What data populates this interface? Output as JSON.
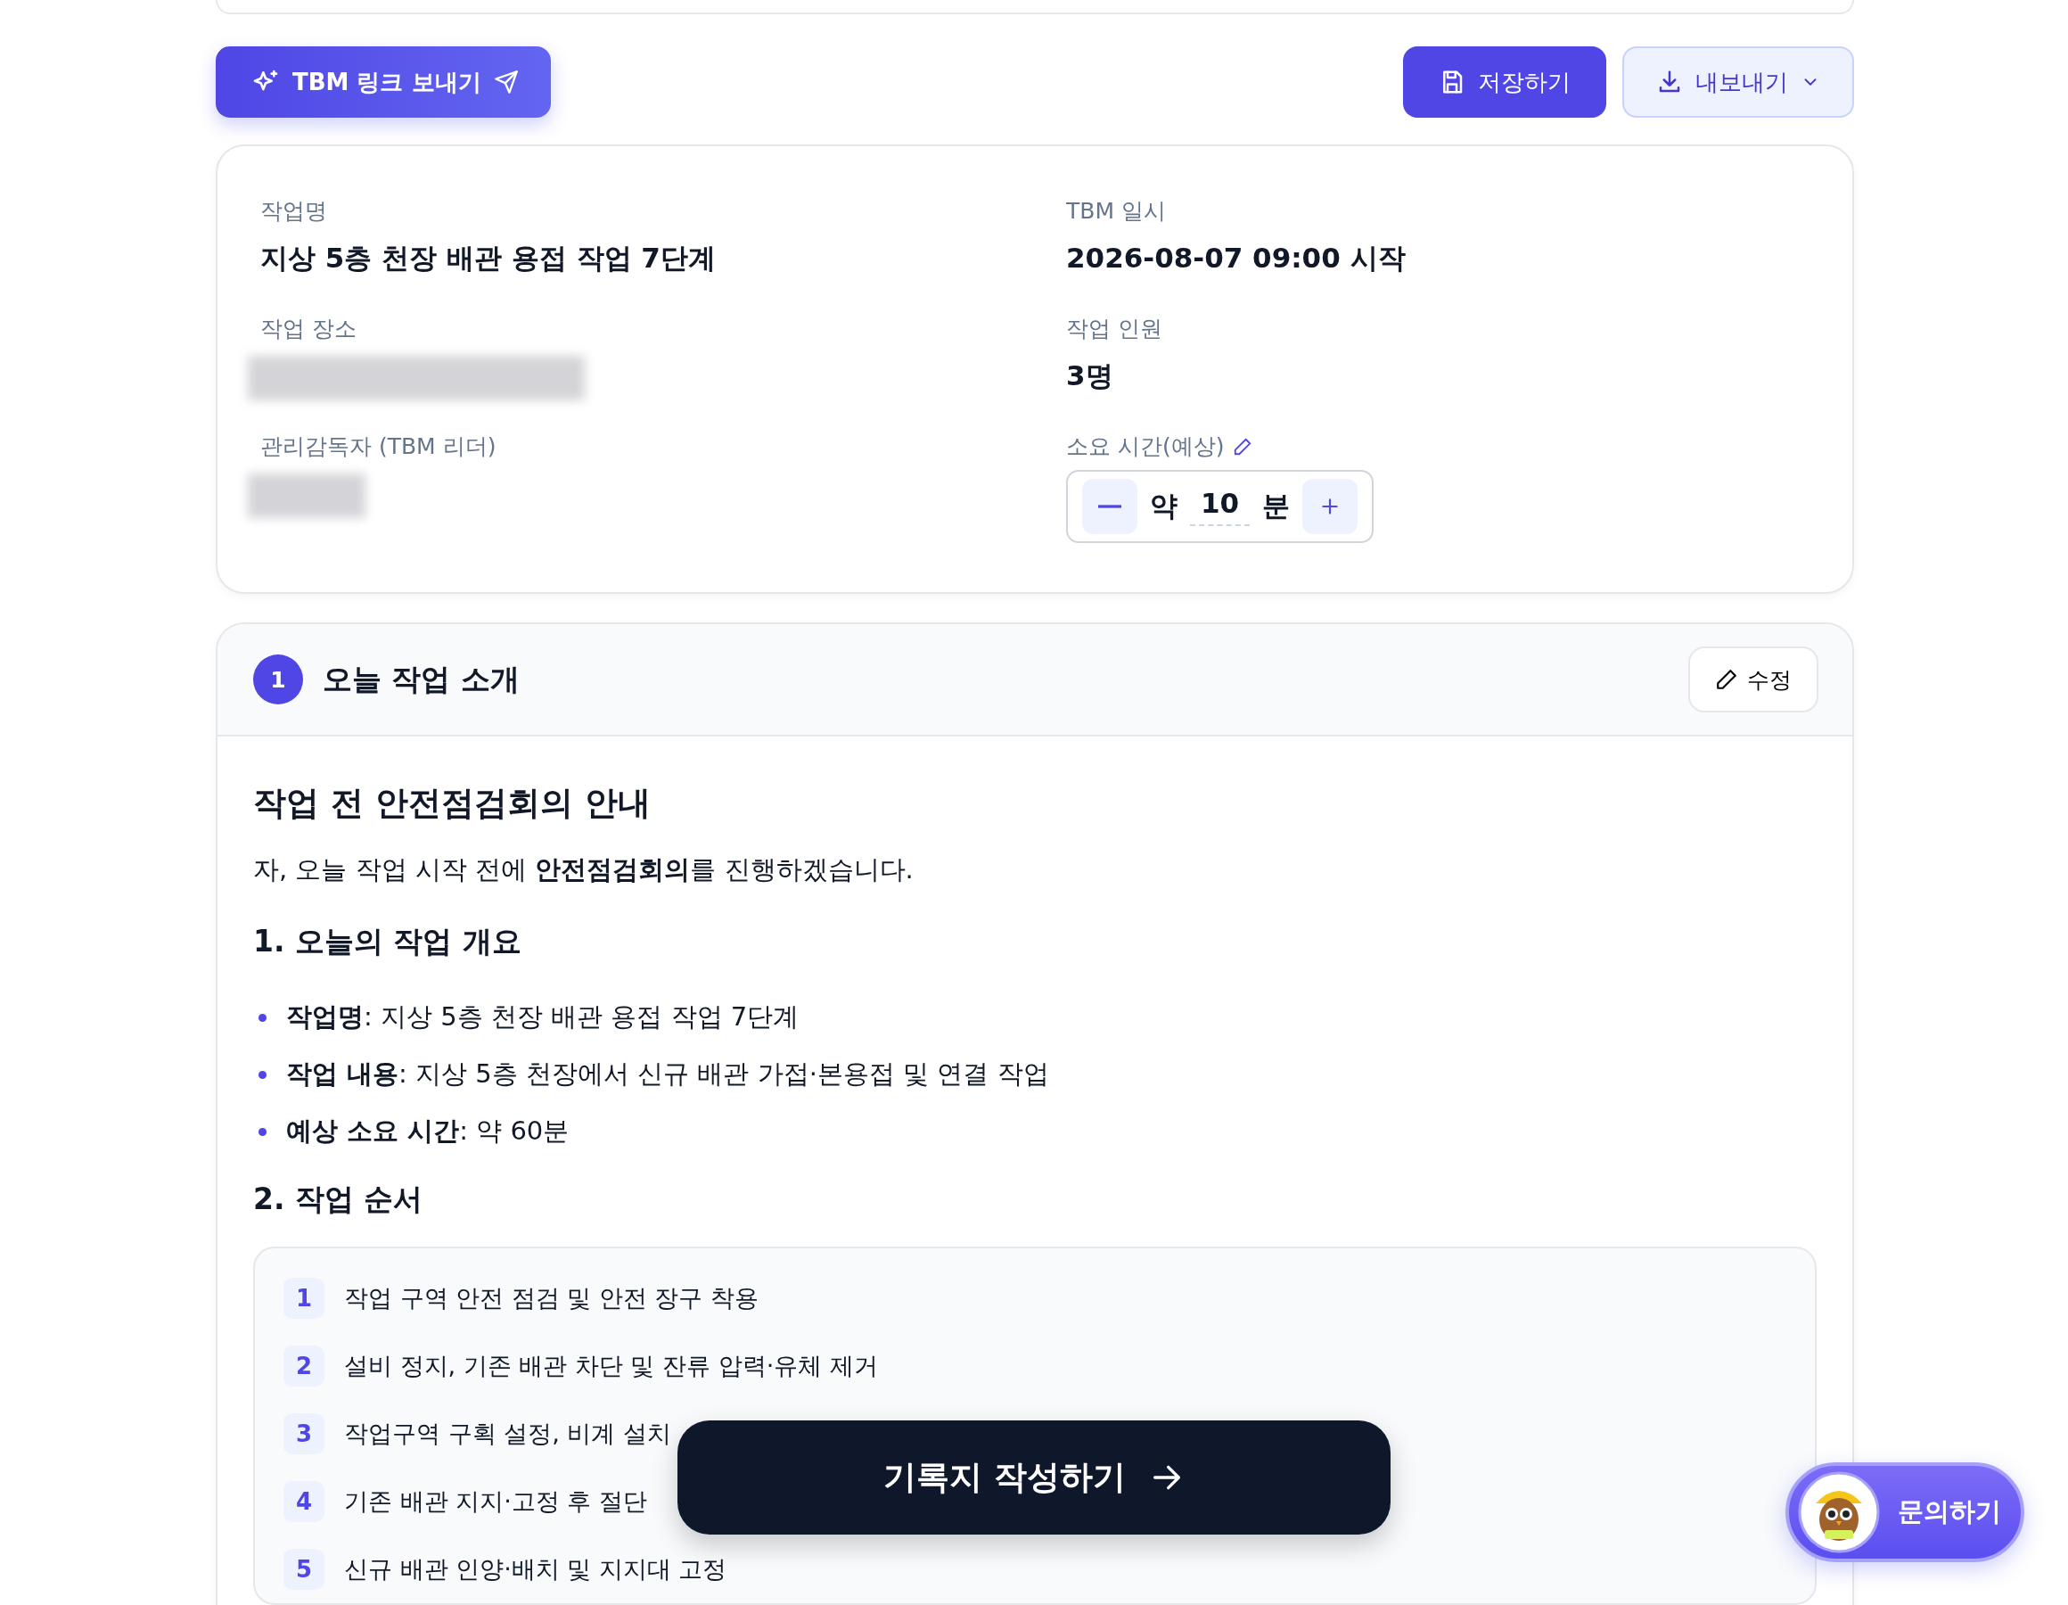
{
  "actions": {
    "share_button": "TBM 링크 보내기",
    "save_button": "저장하기",
    "export_button": "내보내기"
  },
  "info": {
    "columns": [
      [
        {
          "kind": "text",
          "label": "작업명",
          "value": "지상 5층 천장 배관 용접 작업 7단계"
        },
        {
          "kind": "redacted",
          "label": "작업 장소"
        },
        {
          "kind": "redacted",
          "label": "관리감독자 (TBM 리더)"
        }
      ],
      [
        {
          "kind": "text",
          "label": "TBM 일시",
          "value": "2026-08-07 09:00 시작"
        },
        {
          "kind": "text",
          "label": "작업 인원",
          "value": "3명"
        },
        {
          "kind": "stepper",
          "label": "소요 시간(예상)",
          "prefix": "약",
          "value": "10",
          "unit": "분"
        }
      ]
    ]
  },
  "section": {
    "number": "1",
    "title": "오늘 작업 소개",
    "edit_button": "수정",
    "heading": "작업 전 안전점검회의 안내",
    "intro": "자, 오늘 작업 시작 전에 **안전점검회의**를 진행하겠습니다.",
    "overview_heading": "1. 오늘의 작업 개요",
    "overview_items": [
      "**작업명**: 지상 5층 천장 배관 용접 작업 7단계",
      "**작업 내용**: 지상 5층 천장에서 신규 배관 가접·본용접 및 연결 작업",
      "**예상 소요 시간**: 약 60분"
    ],
    "steps_heading": "2. 작업 순서",
    "steps": [
      {
        "number": "1",
        "text": "작업 구역 안전 점검 및 안전 장구 착용"
      },
      {
        "number": "2",
        "text": "설비 정지, 기존 배관 차단 및 잔류 압력·유체 제거"
      },
      {
        "number": "3",
        "text": "작업구역 구획 설정, 비계 설치"
      },
      {
        "number": "4",
        "text": "기존 배관 지지·고정 후 절단"
      },
      {
        "number": "5",
        "text": "신규 배관 인양·배치 및 지지대 고정"
      }
    ]
  },
  "cta_button": "기록지 작성하기",
  "inquiry_button": "문의하기"
}
